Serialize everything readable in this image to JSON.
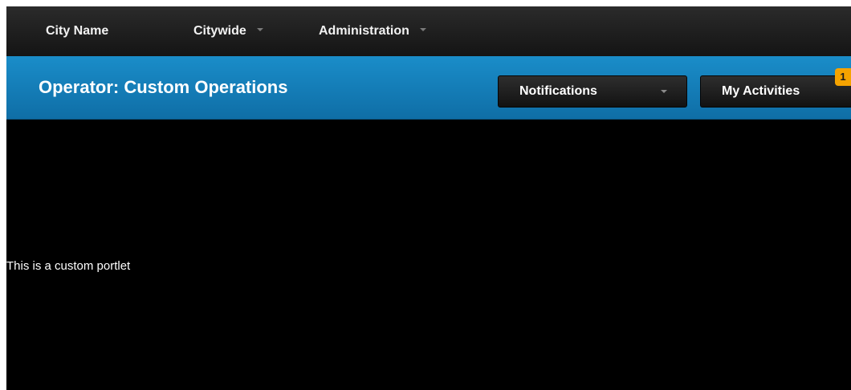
{
  "topnav": {
    "items": [
      {
        "label": "City Name",
        "has_menu": false
      },
      {
        "label": "Citywide",
        "has_menu": true
      },
      {
        "label": "Administration",
        "has_menu": true
      }
    ]
  },
  "header": {
    "title": "Operator: Custom Operations",
    "notifications_label": "Notifications",
    "activities_label": "My Activities",
    "activities_badge": "1"
  },
  "portlet": {
    "text": "This is a custom portlet"
  },
  "colors": {
    "topbar": "#1e1e1e",
    "header_bar": "#1582bf",
    "badge": "#f5a300",
    "content_bg": "#000000"
  }
}
